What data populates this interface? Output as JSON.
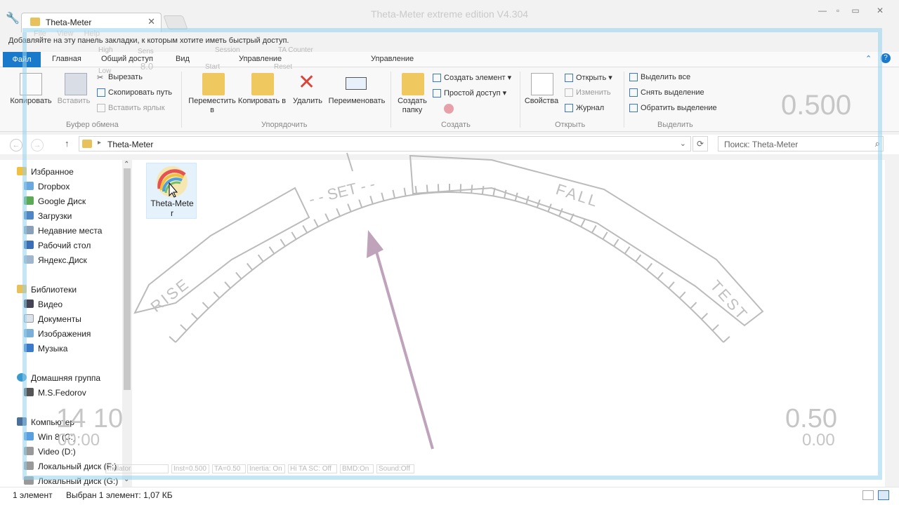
{
  "window": {
    "tab_title": "Theta-Meter",
    "title": "Theta-Meter extreme edition V4.304",
    "overlay_menu": [
      "File",
      "View",
      "Help"
    ],
    "bookmark_hint": "Добавляйте на эту панель закладки, к которым хотите иметь быстрый доступ."
  },
  "ribbon_tabs": {
    "file": "Файл",
    "home": "Главная",
    "share": "Общий доступ",
    "view": "Вид",
    "manage": "Управление",
    "manage2": "Управление"
  },
  "ribbon": {
    "clipboard": {
      "copy": "Копировать",
      "paste": "Вставить",
      "cut": "Вырезать",
      "copy_path": "Скопировать путь",
      "paste_shortcut": "Вставить ярлык",
      "group": "Буфер обмена"
    },
    "organize": {
      "move_to": "Переместить в",
      "copy_to": "Копировать в",
      "delete": "Удалить",
      "rename": "Переименовать",
      "group": "Упорядочить"
    },
    "create": {
      "new_folder": "Создать папку",
      "new_item": "Создать элемент",
      "easy_access": "Простой доступ",
      "group": "Создать"
    },
    "open": {
      "properties": "Свойства",
      "open": "Открыть",
      "edit": "Изменить",
      "history": "Журнал",
      "group": "Открыть"
    },
    "select": {
      "select_all": "Выделить все",
      "select_none": "Снять выделение",
      "invert": "Обратить выделение",
      "group": "Выделить"
    }
  },
  "address": {
    "path": "Theta-Meter",
    "search_placeholder": "Поиск: Theta-Meter"
  },
  "nav": {
    "favorites": "Избранное",
    "favorites_items": [
      "Dropbox",
      "Google Диск",
      "Загрузки",
      "Недавние места",
      "Рабочий стол",
      "Яндекс.Диск"
    ],
    "libraries": "Библиотеки",
    "libraries_items": [
      "Видео",
      "Документы",
      "Изображения",
      "Музыка"
    ],
    "homegroup": "Домашняя группа",
    "homegroup_items": [
      "M.S.Fedorov"
    ],
    "computer": "Компьютер",
    "computer_items": [
      "Win 8 (C:)",
      "Video (D:)",
      "Локальный диск (F:)",
      "Локальный диск (G:)"
    ]
  },
  "content": {
    "file_name_line1": "Theta-Mete",
    "file_name_line2": "r"
  },
  "meter": {
    "scale_labels": [
      "RISE",
      "- - SET - -",
      "FALL",
      "TEST"
    ],
    "sens_label": "Sens",
    "sens_value": "8.0",
    "high": "High",
    "low": "Low",
    "session": "Session",
    "ta_counter": "TA Counter",
    "start": "Start",
    "reset": "Reset",
    "top_right_value": "0.500",
    "left_time_big": "14 10",
    "left_time_small": "00:00",
    "right_value_big": "0.50",
    "right_value_small": "0.00",
    "status_items": [
      "mulator",
      "Inst=0.500",
      "TA=0.50",
      "Inertia: On",
      "Hi TA SC: Off",
      "BMD:On",
      "Sound:Off"
    ],
    "needle_color": "#b89ab4"
  },
  "status": {
    "count": "1 элемент",
    "selected": "Выбран 1 элемент: 1,07 КБ"
  }
}
